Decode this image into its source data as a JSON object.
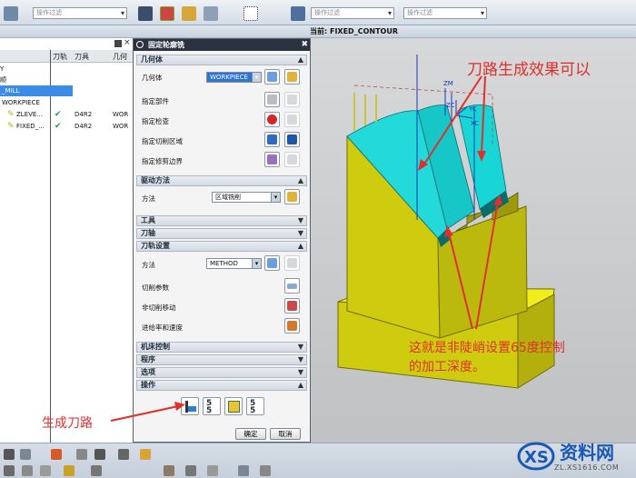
{
  "toolbar": {
    "combo1": "操作过滤",
    "combo2": "操作过滤",
    "combo3": "操作过滤"
  },
  "viewport": {
    "current_label": "当前: FIXED_CONTOUR",
    "axis_zm": "ZM",
    "axis_zc": "ZC",
    "axis_xc": "XC",
    "axis_yc": "YC"
  },
  "navigator": {
    "headers": [
      "刀轨",
      "刀具",
      "几何"
    ],
    "rows": [
      {
        "name": "Y",
        "tool": "",
        "geom": "",
        "check": false,
        "selected": false
      },
      {
        "name": "顺",
        "tool": "",
        "geom": "",
        "check": false,
        "selected": false
      },
      {
        "name": "_MILL",
        "tool": "",
        "geom": "",
        "check": false,
        "selected": true
      },
      {
        "name": "WORKPIECE",
        "tool": "",
        "geom": "",
        "check": false,
        "selected": false
      },
      {
        "name": "ZLEVE...",
        "tool": "D4R2",
        "geom": "WOR",
        "check": true,
        "selected": false
      },
      {
        "name": "FIXED_...",
        "tool": "D4R2",
        "geom": "WOR",
        "check": true,
        "selected": false
      }
    ]
  },
  "dialog": {
    "title": "固定轮廓铣",
    "sections": {
      "geometry": "几何体",
      "drive": "驱动方法",
      "tool": "工具",
      "tool_axis": "刀轴",
      "path_settings": "刀轨设置",
      "machine_control": "机床控制",
      "program": "程序",
      "options": "选项",
      "actions": "操作"
    },
    "geometry_label": "几何体",
    "geometry_value": "WORKPIECE",
    "specify_part": "指定部件",
    "specify_check": "指定检查",
    "specify_cut_area": "指定切削区域",
    "specify_trim": "指定修剪边界",
    "method_label": "方法",
    "drive_method_value": "区域铣削",
    "path_method_value": "METHOD",
    "cut_params": "切削参数",
    "non_cut_moves": "非切削移动",
    "feeds_speeds": "进给率和速度",
    "ok": "确定",
    "cancel": "取消"
  },
  "annotations": {
    "top_right": "刀路生成效果可以",
    "right_line1": "这就是非陡峭设置65度控制",
    "right_line2": "的加工深度。",
    "left": "生成刀路"
  },
  "watermark": {
    "name": "资料网",
    "url": "ZL.XS1616.COM"
  },
  "colors": {
    "annotation": "#e0302a",
    "part_yellow": "#cfcc10",
    "part_cyan": "#19d6d6",
    "selection": "#3b8ce6"
  }
}
